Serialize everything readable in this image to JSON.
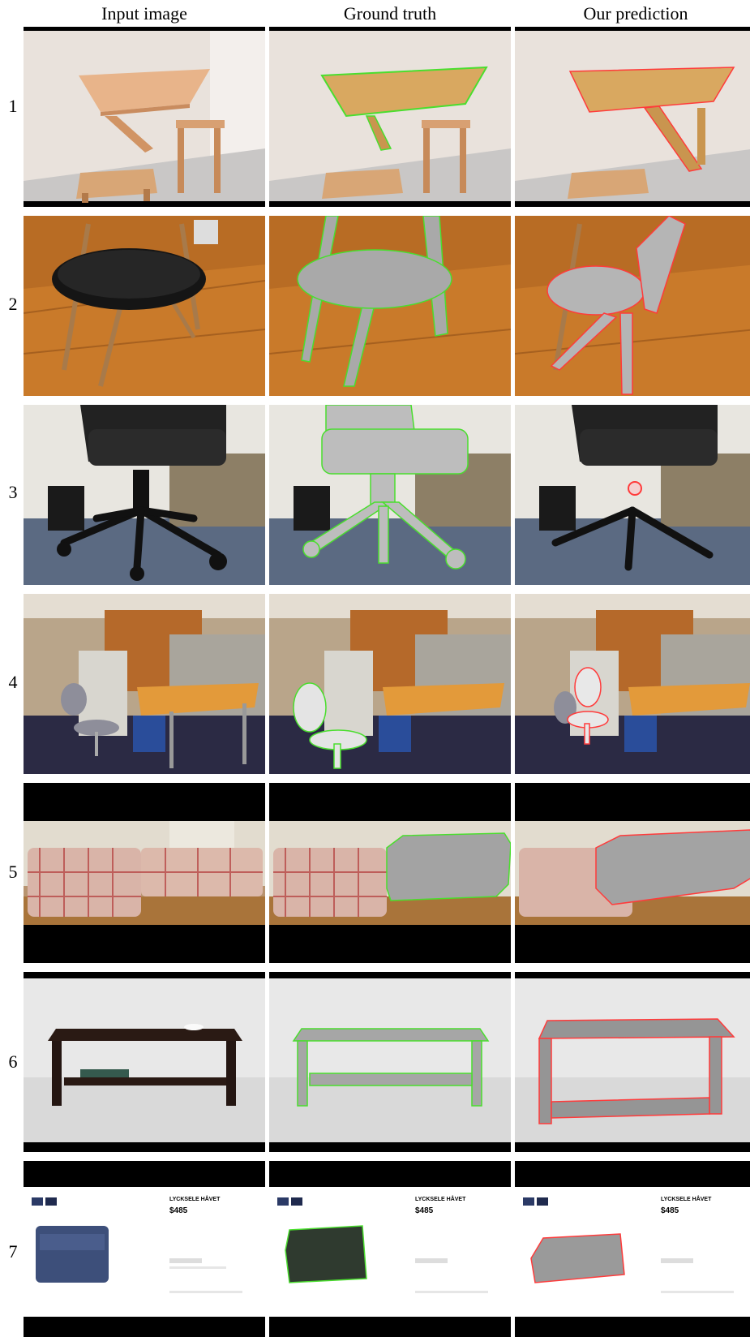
{
  "figure": {
    "columns": [
      "Input image",
      "Ground truth",
      "Our prediction"
    ],
    "rows": [
      {
        "label": "1"
      },
      {
        "label": "2"
      },
      {
        "label": "3"
      },
      {
        "label": "4"
      },
      {
        "label": "5"
      },
      {
        "label": "6"
      },
      {
        "label": "7"
      }
    ],
    "outline_colors": {
      "ground_truth": "#4ade2e",
      "prediction": "#ff3b3b"
    },
    "product_page": {
      "title": "LYCKSELE HÅVET",
      "price": "$485"
    }
  }
}
